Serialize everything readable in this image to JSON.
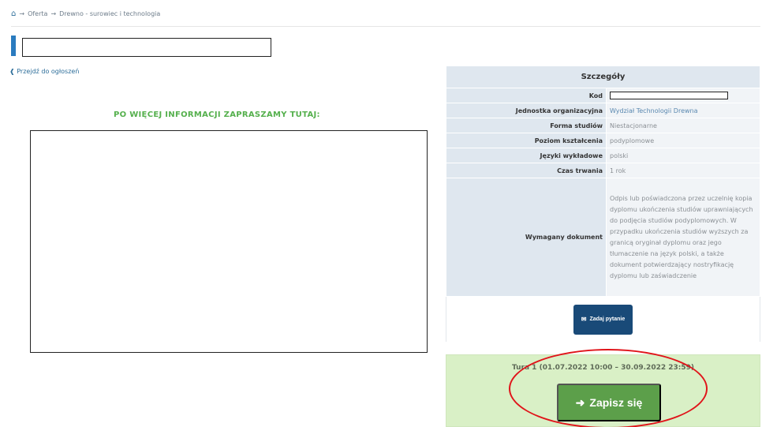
{
  "breadcrumb": {
    "home_icon": "home-icon",
    "items": [
      "Oferta",
      "Drewno - surowiec i technologia"
    ]
  },
  "back_link": "Przejdź do ogłoszeń",
  "promo": {
    "heading": "PO WIĘCEJ INFORMACJI ZAPRASZAMY TUTAJ:"
  },
  "details": {
    "header": "Szczegóły",
    "rows": [
      {
        "label": "Kod",
        "value": ""
      },
      {
        "label": "Jednostka organizacyjna",
        "value": "Wydział Technologii Drewna"
      },
      {
        "label": "Forma studiów",
        "value": "Niestacjonarne"
      },
      {
        "label": "Poziom kształcenia",
        "value": "podyplomowe"
      },
      {
        "label": "Języki wykładowe",
        "value": "polski"
      },
      {
        "label": "Czas trwania",
        "value": "1 rok"
      },
      {
        "label": "Wymagany dokument",
        "value": "Odpis lub poświadczona przez uczelnię kopia dyplomu ukończenia studiów uprawniających do podjęcia studiów podyplomowych. W przypadku ukończenia studiów wyższych za granicą oryginał dyplomu oraz jego tłumaczenie na język polski, a także dokument potwierdzający nostryfikację dyplomu lub zaświadczenie"
      }
    ],
    "ask_button": "Zadaj pytanie"
  },
  "enroll": {
    "tura_label": "Tura 1",
    "tura_dates": "(01.07.2022 10:00 – 30.09.2022 23:59)",
    "button": "Zapisz się"
  },
  "colors": {
    "accent_blue": "#2a7bbf",
    "button_navy": "#194a78",
    "enroll_green": "#5c9f4a",
    "panel_green": "#d9f0c6",
    "promo_green": "#55b04d",
    "annotation_red": "#e0141a"
  }
}
